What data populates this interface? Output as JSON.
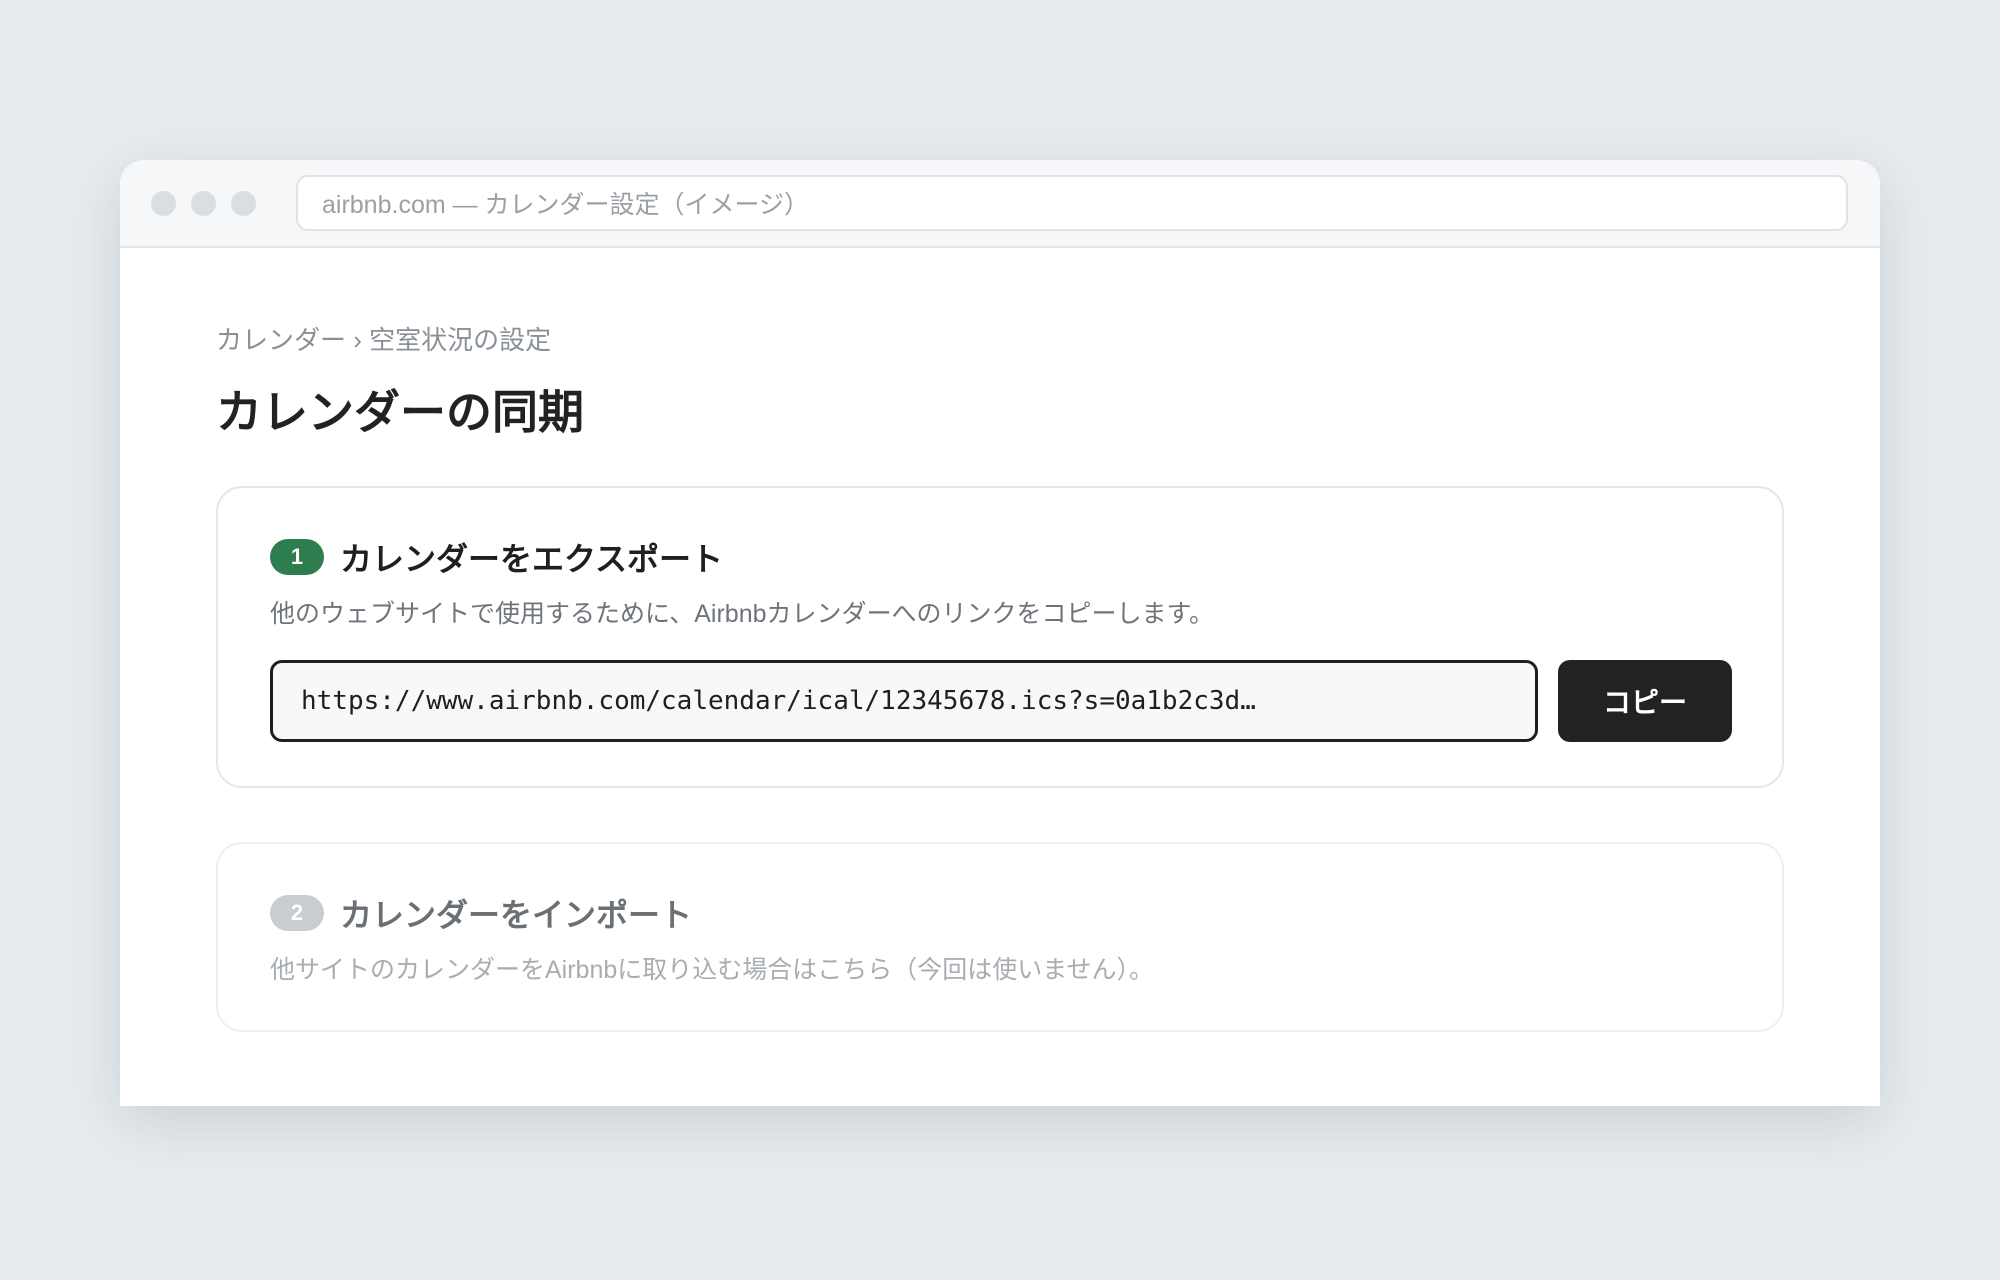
{
  "browser": {
    "address": "airbnb.com — カレンダー設定（イメージ）"
  },
  "page": {
    "breadcrumb": "カレンダー › 空室状況の設定",
    "title": "カレンダーの同期"
  },
  "export_step": {
    "number": "1",
    "title": "カレンダーをエクスポート",
    "description": "他のウェブサイトで使用するために、Airbnbカレンダーへのリンクをコピーします。",
    "url_value": "https://www.airbnb.com/calendar/ical/12345678.ics?s=0a1b2c3d…",
    "copy_label": "コピー"
  },
  "import_step": {
    "number": "2",
    "title": "カレンダーをインポート",
    "description": "他サイトのカレンダーをAirbnbに取り込む場合はこちら（今回は使いません）。"
  },
  "colors": {
    "active_badge": "#2e7d4f",
    "inactive_badge": "#c9ccd1",
    "active_title": "#1f1f1f",
    "inactive_title": "#6b7075",
    "active_desc": "#6e747a",
    "inactive_desc": "#a8adb2",
    "button_bg": "#222222"
  }
}
